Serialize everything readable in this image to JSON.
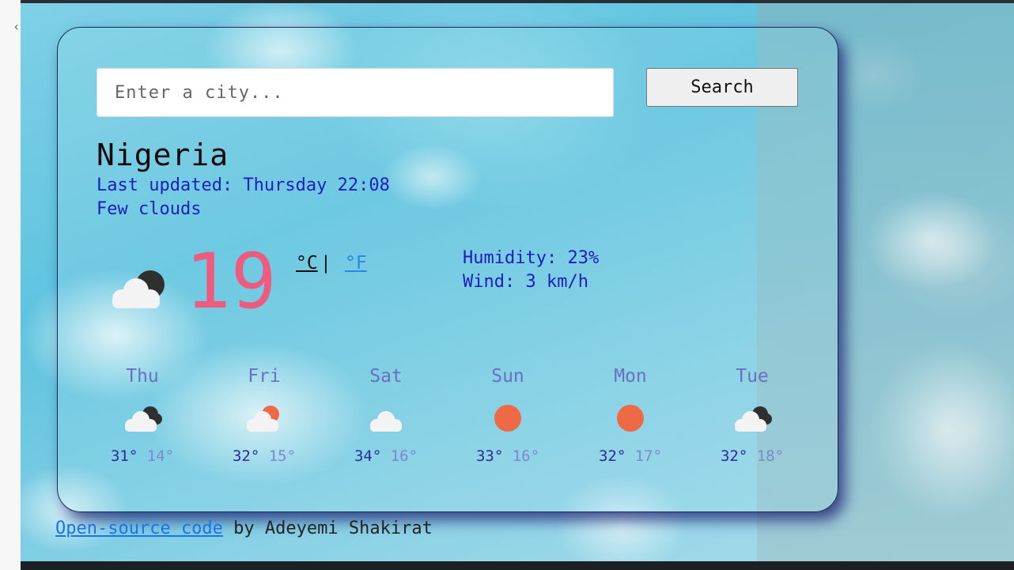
{
  "search": {
    "placeholder": "Enter a city...",
    "button_label": "Search"
  },
  "current": {
    "city": "Nigeria",
    "last_updated": "Last updated: Thursday 22:08",
    "description": "Few clouds",
    "icon": "few-clouds-night-icon",
    "temperature": "19",
    "unit_celsius": "°C",
    "unit_separator": "|",
    "unit_fahrenheit": "°F",
    "humidity": "Humidity: 23%",
    "wind": "Wind: 3 km/h"
  },
  "forecast": [
    {
      "day": "Thu",
      "icon": "cloud-night-icon",
      "max": "31°",
      "min": "14°"
    },
    {
      "day": "Fri",
      "icon": "cloud-sun-icon",
      "max": "32°",
      "min": "15°"
    },
    {
      "day": "Sat",
      "icon": "cloud-icon",
      "max": "34°",
      "min": "16°"
    },
    {
      "day": "Sun",
      "icon": "sun-icon",
      "max": "33°",
      "min": "16°"
    },
    {
      "day": "Mon",
      "icon": "sun-icon",
      "max": "32°",
      "min": "17°"
    },
    {
      "day": "Tue",
      "icon": "cloud-night-icon",
      "max": "32°",
      "min": "18°"
    }
  ],
  "footer": {
    "link_text": "Open-source code",
    "suffix": " by Adeyemi Shakirat"
  },
  "colors": {
    "temperature": "#ef5b7e",
    "info_blue": "#1e1ebe",
    "sun": "#ee6a45",
    "link": "#1a73e8"
  }
}
